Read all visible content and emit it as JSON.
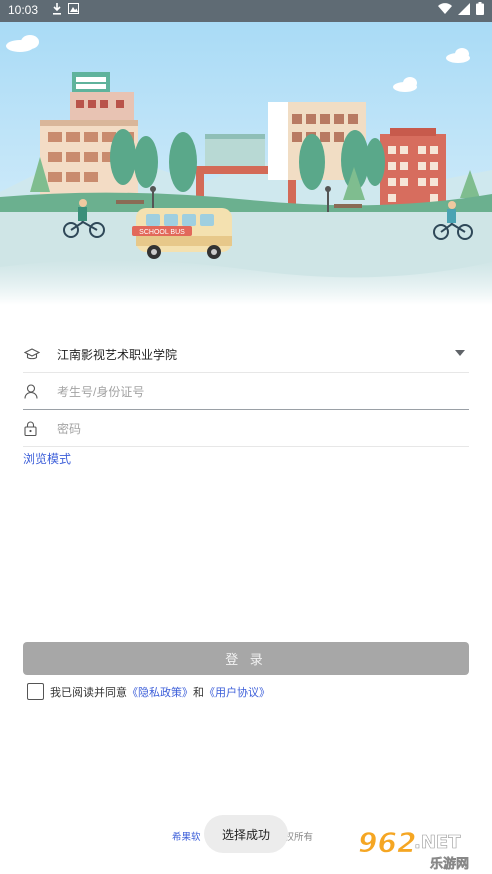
{
  "status_bar": {
    "time": "10:03",
    "left_icons": [
      "download-icon",
      "image-icon"
    ],
    "right_icons": [
      "wifi-icon",
      "signal-icon",
      "battery-icon"
    ]
  },
  "hero": {
    "bus_text": "SCHOOL BUS"
  },
  "form": {
    "school": {
      "value": "江南影视艺术职业学院",
      "icon": "graduation-cap-icon"
    },
    "username": {
      "placeholder": "考生号/身份证号",
      "icon": "user-icon"
    },
    "password": {
      "placeholder": "密码",
      "icon": "lock-icon"
    }
  },
  "browse_mode": "浏览模式",
  "login_button": "登 录",
  "agreement": {
    "prefix": "我已阅读并同意",
    "privacy": "《隐私政策》",
    "and": "和",
    "user_agreement": "《用户协议》"
  },
  "footer": {
    "brand": "希果软",
    "suffix": "权所有"
  },
  "toast": "选择成功",
  "watermark": {
    "number": "962",
    "net": ".NET",
    "label": "乐游网"
  },
  "colors": {
    "status_bar": "#5f6b74",
    "link": "#3d5fd9",
    "button_disabled": "#a7a7a7",
    "sky": "#bfe3f7"
  }
}
